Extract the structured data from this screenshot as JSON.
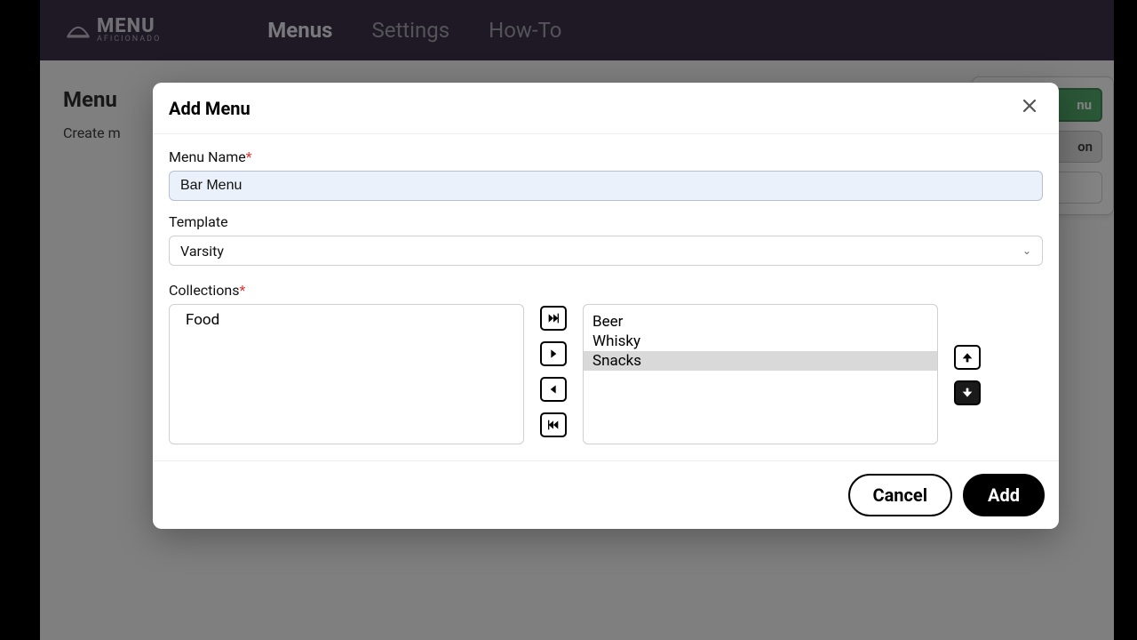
{
  "header": {
    "brand_main": "MENU",
    "brand_sub": "AFICIONADO",
    "nav": [
      "Menus",
      "Settings",
      "How-To"
    ],
    "active_nav": "Menus"
  },
  "page": {
    "title_fragment": "Menu",
    "subtitle_fragment": "Create m",
    "side_green": "nu",
    "side_grey": "on"
  },
  "modal": {
    "title": "Add Menu",
    "menu_name_label": "Menu Name",
    "menu_name_value": "Bar Menu",
    "template_label": "Template",
    "template_value": "Varsity",
    "collections_label": "Collections",
    "available": [
      "Food"
    ],
    "selected": [
      "Beer",
      "Whisky",
      "Snacks"
    ],
    "selected_highlight": "Snacks",
    "cancel": "Cancel",
    "add": "Add"
  }
}
